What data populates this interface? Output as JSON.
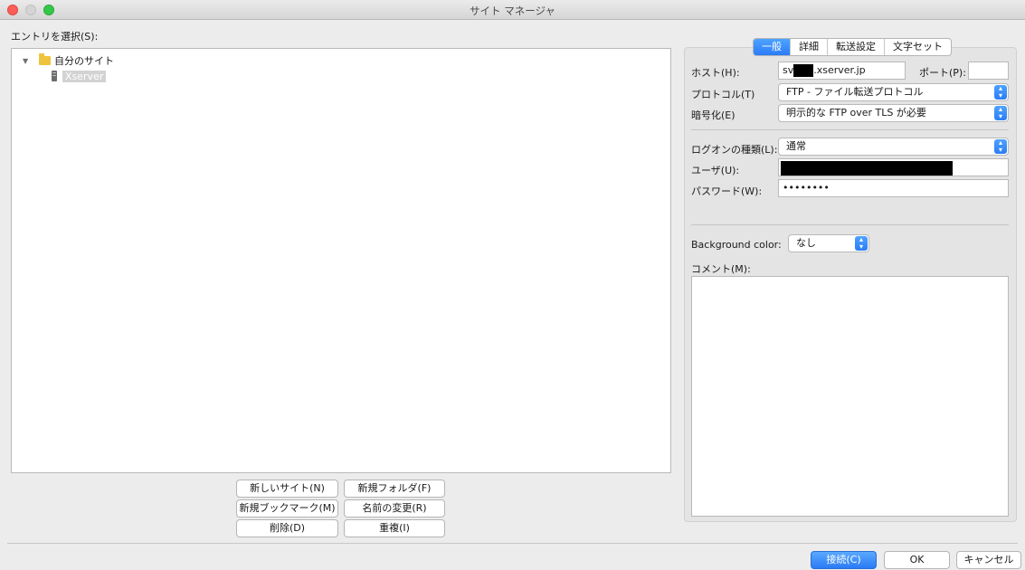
{
  "window": {
    "title": "サイト マネージャ"
  },
  "entry_label": "エントリを選択(S):",
  "tree": {
    "root_label": "自分のサイト",
    "child_label": "Xserver"
  },
  "left_buttons": {
    "new_site": "新しいサイト(N)",
    "new_folder": "新規フォルダ(F)",
    "new_bookmark": "新規ブックマーク(M)",
    "rename": "名前の変更(R)",
    "delete": "削除(D)",
    "duplicate": "重複(I)"
  },
  "tabs": [
    "一般",
    "詳細",
    "転送設定",
    "文字セット"
  ],
  "form": {
    "host_label": "ホスト(H):",
    "host_prefix": "sv",
    "host_suffix": ".xserver.jp",
    "port_label": "ポート(P):",
    "port_value": "",
    "protocol_label": "プロトコル(T)",
    "protocol_value": "FTP - ファイル転送プロトコル",
    "encryption_label": "暗号化(E)",
    "encryption_value": "明示的な FTP over TLS が必要",
    "logon_label": "ログオンの種類(L):",
    "logon_value": "通常",
    "user_label": "ユーザ(U):",
    "password_label": "パスワード(W):",
    "password_value": "••••••••",
    "bgcolor_label": "Background color:",
    "bgcolor_value": "なし",
    "comment_label": "コメント(M):"
  },
  "footer": {
    "connect": "接続(C)",
    "ok": "OK",
    "cancel": "キャンセル"
  },
  "colors": {
    "accent": "#2b7cf7",
    "folder": "#f0c33c",
    "close_dot": "#fc5f57",
    "max_dot": "#34c84a"
  }
}
